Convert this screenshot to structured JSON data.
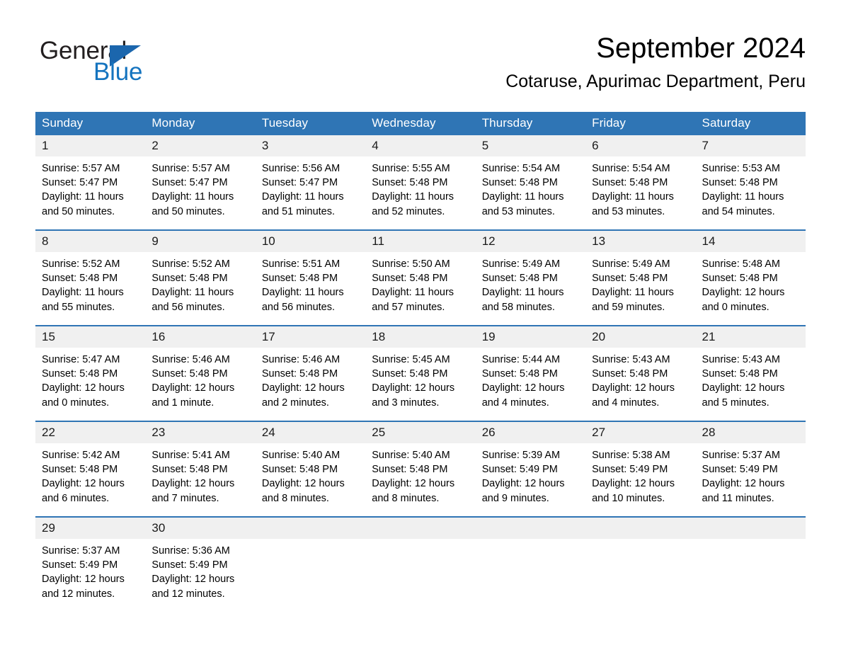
{
  "brand": {
    "name_part1": "General",
    "name_part2": "Blue",
    "triangle_color": "#1b66ad",
    "blue_color": "#1574bf"
  },
  "header": {
    "title": "September 2024",
    "subtitle": "Cotaruse, Apurimac Department, Peru"
  },
  "theme": {
    "header_blue": "#2f75b5",
    "daynum_band": "#f0f0f0",
    "text": "#000000"
  },
  "calendar": {
    "weekday_headers": [
      "Sunday",
      "Monday",
      "Tuesday",
      "Wednesday",
      "Thursday",
      "Friday",
      "Saturday"
    ],
    "weeks": [
      [
        {
          "day": "1",
          "sunrise": "Sunrise: 5:57 AM",
          "sunset": "Sunset: 5:47 PM",
          "daylight": "Daylight: 11 hours and 50 minutes."
        },
        {
          "day": "2",
          "sunrise": "Sunrise: 5:57 AM",
          "sunset": "Sunset: 5:47 PM",
          "daylight": "Daylight: 11 hours and 50 minutes."
        },
        {
          "day": "3",
          "sunrise": "Sunrise: 5:56 AM",
          "sunset": "Sunset: 5:47 PM",
          "daylight": "Daylight: 11 hours and 51 minutes."
        },
        {
          "day": "4",
          "sunrise": "Sunrise: 5:55 AM",
          "sunset": "Sunset: 5:48 PM",
          "daylight": "Daylight: 11 hours and 52 minutes."
        },
        {
          "day": "5",
          "sunrise": "Sunrise: 5:54 AM",
          "sunset": "Sunset: 5:48 PM",
          "daylight": "Daylight: 11 hours and 53 minutes."
        },
        {
          "day": "6",
          "sunrise": "Sunrise: 5:54 AM",
          "sunset": "Sunset: 5:48 PM",
          "daylight": "Daylight: 11 hours and 53 minutes."
        },
        {
          "day": "7",
          "sunrise": "Sunrise: 5:53 AM",
          "sunset": "Sunset: 5:48 PM",
          "daylight": "Daylight: 11 hours and 54 minutes."
        }
      ],
      [
        {
          "day": "8",
          "sunrise": "Sunrise: 5:52 AM",
          "sunset": "Sunset: 5:48 PM",
          "daylight": "Daylight: 11 hours and 55 minutes."
        },
        {
          "day": "9",
          "sunrise": "Sunrise: 5:52 AM",
          "sunset": "Sunset: 5:48 PM",
          "daylight": "Daylight: 11 hours and 56 minutes."
        },
        {
          "day": "10",
          "sunrise": "Sunrise: 5:51 AM",
          "sunset": "Sunset: 5:48 PM",
          "daylight": "Daylight: 11 hours and 56 minutes."
        },
        {
          "day": "11",
          "sunrise": "Sunrise: 5:50 AM",
          "sunset": "Sunset: 5:48 PM",
          "daylight": "Daylight: 11 hours and 57 minutes."
        },
        {
          "day": "12",
          "sunrise": "Sunrise: 5:49 AM",
          "sunset": "Sunset: 5:48 PM",
          "daylight": "Daylight: 11 hours and 58 minutes."
        },
        {
          "day": "13",
          "sunrise": "Sunrise: 5:49 AM",
          "sunset": "Sunset: 5:48 PM",
          "daylight": "Daylight: 11 hours and 59 minutes."
        },
        {
          "day": "14",
          "sunrise": "Sunrise: 5:48 AM",
          "sunset": "Sunset: 5:48 PM",
          "daylight": "Daylight: 12 hours and 0 minutes."
        }
      ],
      [
        {
          "day": "15",
          "sunrise": "Sunrise: 5:47 AM",
          "sunset": "Sunset: 5:48 PM",
          "daylight": "Daylight: 12 hours and 0 minutes."
        },
        {
          "day": "16",
          "sunrise": "Sunrise: 5:46 AM",
          "sunset": "Sunset: 5:48 PM",
          "daylight": "Daylight: 12 hours and 1 minute."
        },
        {
          "day": "17",
          "sunrise": "Sunrise: 5:46 AM",
          "sunset": "Sunset: 5:48 PM",
          "daylight": "Daylight: 12 hours and 2 minutes."
        },
        {
          "day": "18",
          "sunrise": "Sunrise: 5:45 AM",
          "sunset": "Sunset: 5:48 PM",
          "daylight": "Daylight: 12 hours and 3 minutes."
        },
        {
          "day": "19",
          "sunrise": "Sunrise: 5:44 AM",
          "sunset": "Sunset: 5:48 PM",
          "daylight": "Daylight: 12 hours and 4 minutes."
        },
        {
          "day": "20",
          "sunrise": "Sunrise: 5:43 AM",
          "sunset": "Sunset: 5:48 PM",
          "daylight": "Daylight: 12 hours and 4 minutes."
        },
        {
          "day": "21",
          "sunrise": "Sunrise: 5:43 AM",
          "sunset": "Sunset: 5:48 PM",
          "daylight": "Daylight: 12 hours and 5 minutes."
        }
      ],
      [
        {
          "day": "22",
          "sunrise": "Sunrise: 5:42 AM",
          "sunset": "Sunset: 5:48 PM",
          "daylight": "Daylight: 12 hours and 6 minutes."
        },
        {
          "day": "23",
          "sunrise": "Sunrise: 5:41 AM",
          "sunset": "Sunset: 5:48 PM",
          "daylight": "Daylight: 12 hours and 7 minutes."
        },
        {
          "day": "24",
          "sunrise": "Sunrise: 5:40 AM",
          "sunset": "Sunset: 5:48 PM",
          "daylight": "Daylight: 12 hours and 8 minutes."
        },
        {
          "day": "25",
          "sunrise": "Sunrise: 5:40 AM",
          "sunset": "Sunset: 5:48 PM",
          "daylight": "Daylight: 12 hours and 8 minutes."
        },
        {
          "day": "26",
          "sunrise": "Sunrise: 5:39 AM",
          "sunset": "Sunset: 5:49 PM",
          "daylight": "Daylight: 12 hours and 9 minutes."
        },
        {
          "day": "27",
          "sunrise": "Sunrise: 5:38 AM",
          "sunset": "Sunset: 5:49 PM",
          "daylight": "Daylight: 12 hours and 10 minutes."
        },
        {
          "day": "28",
          "sunrise": "Sunrise: 5:37 AM",
          "sunset": "Sunset: 5:49 PM",
          "daylight": "Daylight: 12 hours and 11 minutes."
        }
      ],
      [
        {
          "day": "29",
          "sunrise": "Sunrise: 5:37 AM",
          "sunset": "Sunset: 5:49 PM",
          "daylight": "Daylight: 12 hours and 12 minutes."
        },
        {
          "day": "30",
          "sunrise": "Sunrise: 5:36 AM",
          "sunset": "Sunset: 5:49 PM",
          "daylight": "Daylight: 12 hours and 12 minutes."
        },
        {
          "day": "",
          "sunrise": "",
          "sunset": "",
          "daylight": ""
        },
        {
          "day": "",
          "sunrise": "",
          "sunset": "",
          "daylight": ""
        },
        {
          "day": "",
          "sunrise": "",
          "sunset": "",
          "daylight": ""
        },
        {
          "day": "",
          "sunrise": "",
          "sunset": "",
          "daylight": ""
        },
        {
          "day": "",
          "sunrise": "",
          "sunset": "",
          "daylight": ""
        }
      ]
    ]
  }
}
